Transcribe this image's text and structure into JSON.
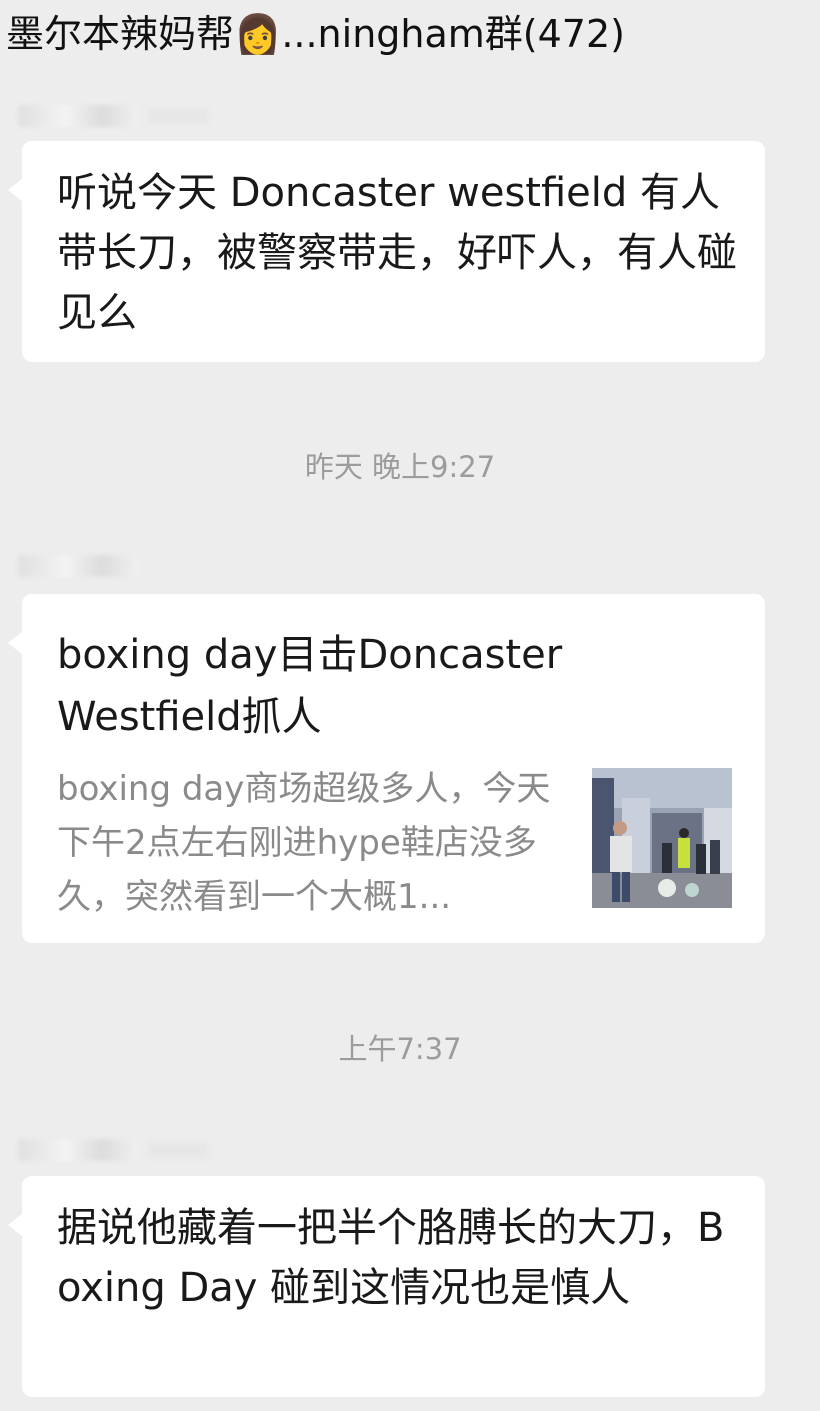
{
  "header": {
    "title": "墨尔本辣妈帮👩...ningham群(472)"
  },
  "messages": [
    {
      "type": "text",
      "sender": "",
      "text": "听说今天 Doncaster westfield 有人带长刀，被警察带走，好吓人，有人碰见么"
    },
    {
      "type": "link",
      "sender": "",
      "title": "boxing day目击Doncaster Westfield抓人",
      "description": "boxing day商场超级多人，今天下午2点左右刚进hype鞋店没多久，突然看到一个大概1...",
      "thumbnail_icon": "store-photo"
    },
    {
      "type": "text",
      "sender": "",
      "text": "据说他藏着一把半个胳膊长的大刀，Boxing Day 碰到这情况也是慎人"
    }
  ],
  "timestamps": [
    "昨天 晚上9:27",
    "上午7:37"
  ],
  "colors": {
    "background": "#ededed",
    "bubble": "#ffffff",
    "timestamp": "#9c9c9c",
    "link_description": "#8a8a8a"
  }
}
